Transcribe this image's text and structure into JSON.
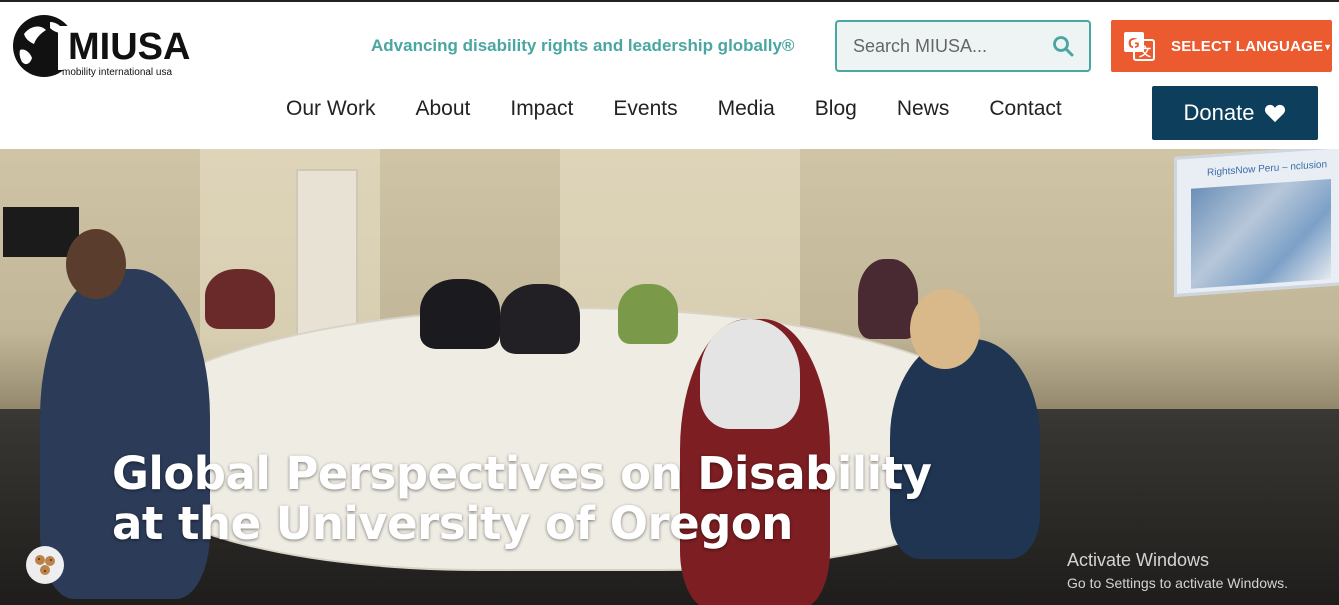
{
  "brand": {
    "name": "MIUSA",
    "subtitle": "mobility international usa",
    "tagline": "Advancing disability rights and leadership globally®"
  },
  "search": {
    "placeholder": "Search MIUSA...",
    "icon": "search-icon"
  },
  "language": {
    "label": "SELECT LANGUAGE",
    "icon": "google-translate-icon",
    "color": "#ec5a2f"
  },
  "nav": {
    "items": [
      {
        "label": "Our Work"
      },
      {
        "label": "About"
      },
      {
        "label": "Impact"
      },
      {
        "label": "Events"
      },
      {
        "label": "Media"
      },
      {
        "label": "Blog"
      },
      {
        "label": "News"
      },
      {
        "label": "Contact"
      }
    ]
  },
  "donate": {
    "label": "Donate",
    "icon": "heart-icon",
    "color": "#0d3e5c"
  },
  "hero": {
    "title_line1": "Global Perspectives on Disability",
    "title_line2": "at the University of Oregon",
    "screen_caption": "RightsNow Peru – nclusion"
  },
  "cookie": {
    "icon": "cookie-icon"
  },
  "watermark": {
    "line1": "Activate Windows",
    "line2": "Go to Settings to activate Windows."
  },
  "colors": {
    "accent": "#4aa6a0",
    "search_bg": "#eef4f4"
  }
}
